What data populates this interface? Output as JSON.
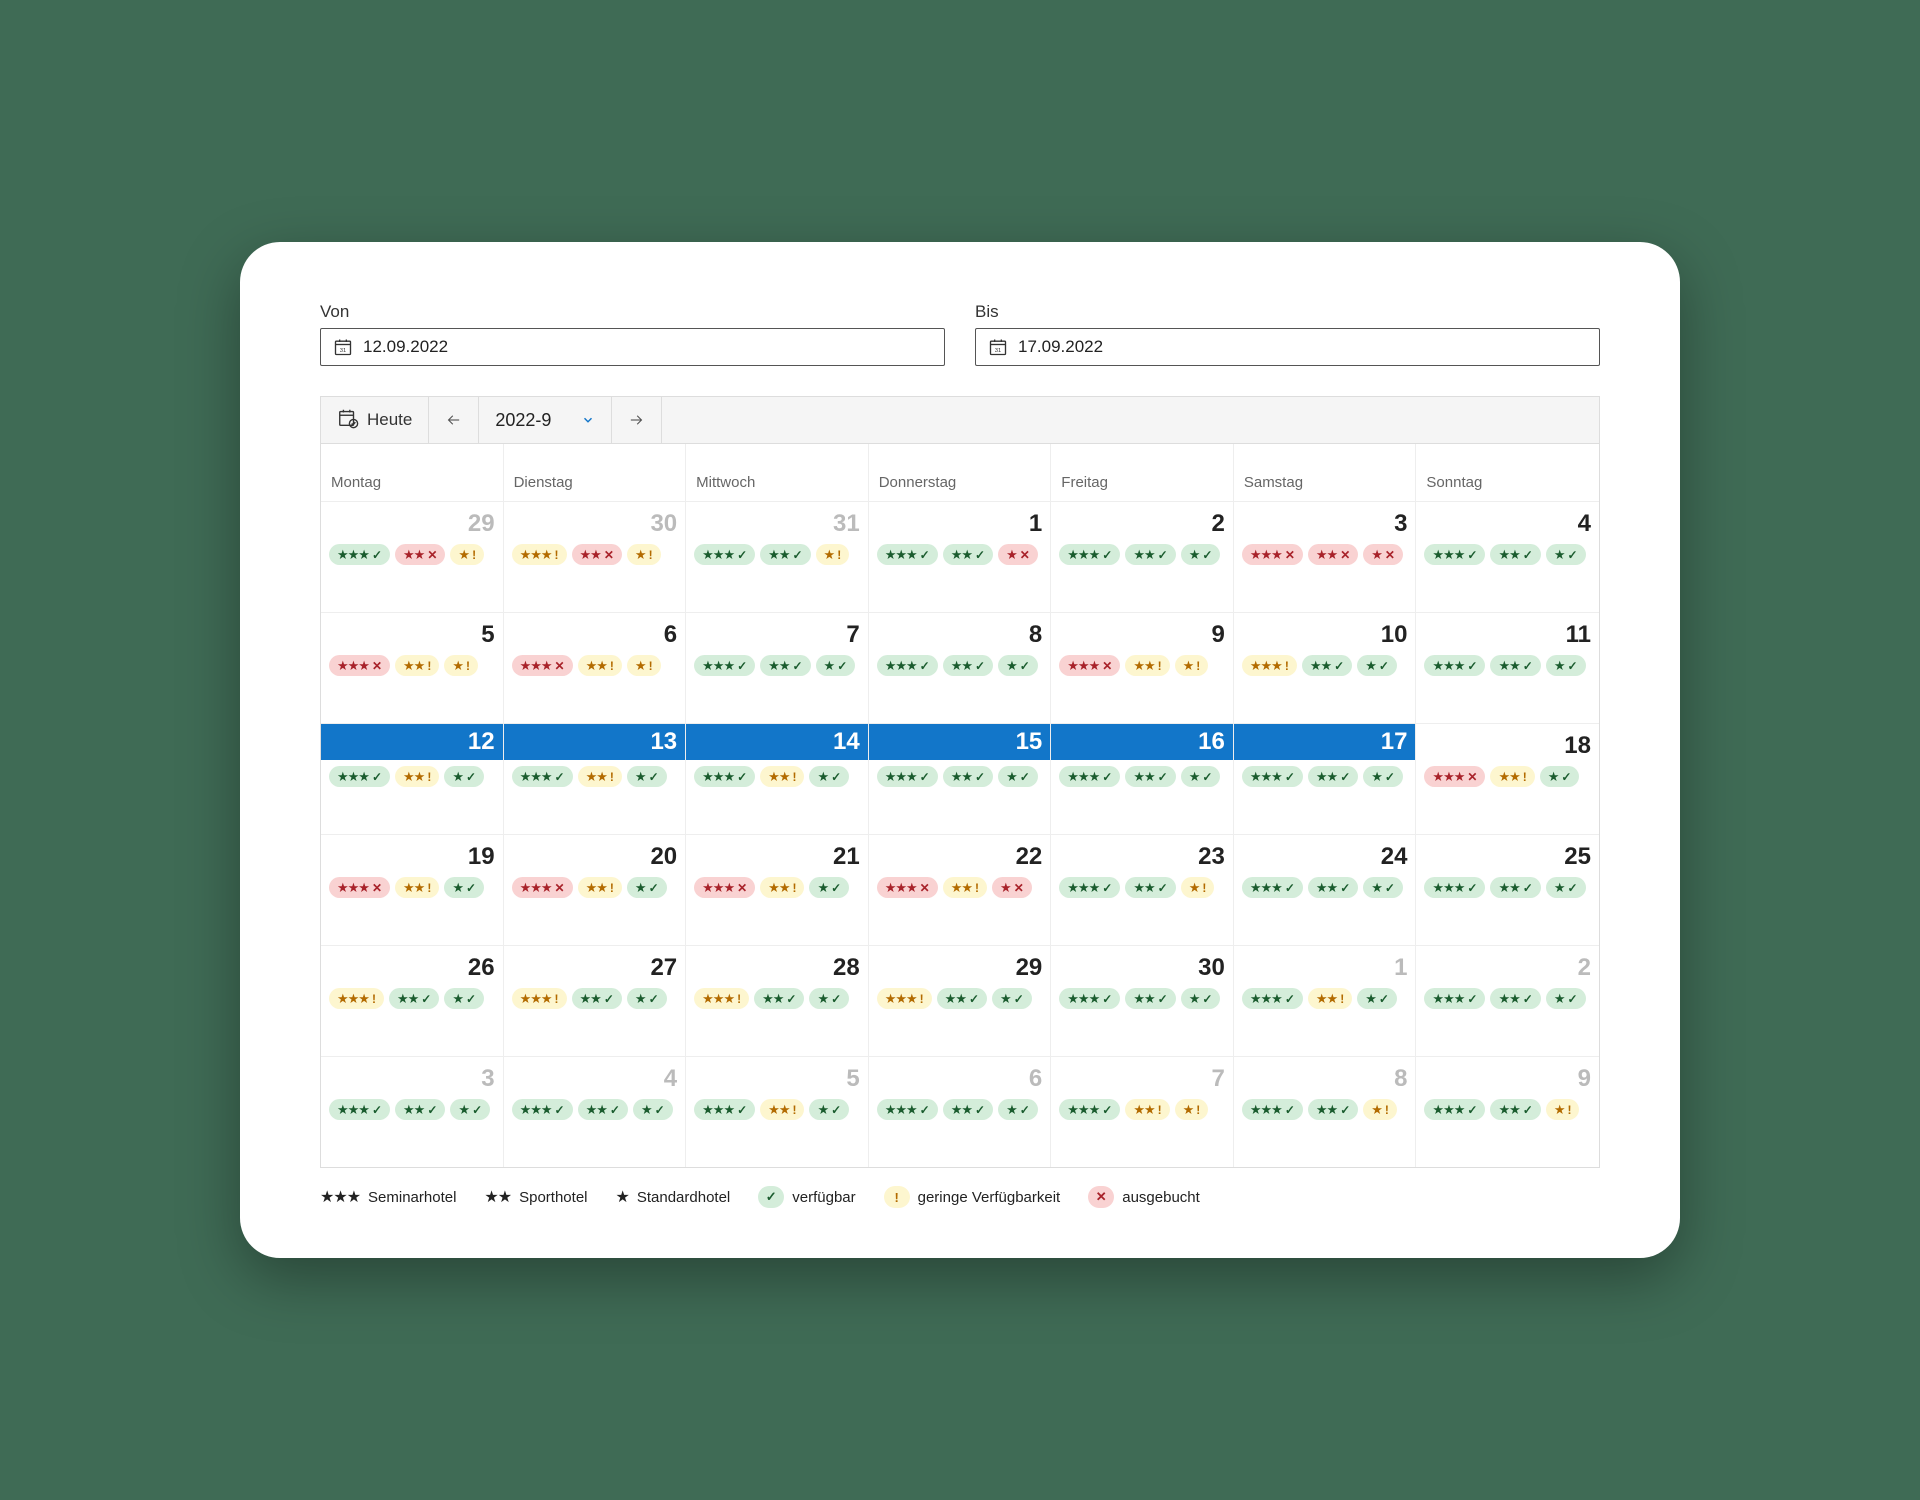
{
  "inputs": {
    "from_label": "Von",
    "from_value": "12.09.2022",
    "to_label": "Bis",
    "to_value": "17.09.2022"
  },
  "toolbar": {
    "today_label": "Heute",
    "month_label": "2022-9"
  },
  "weekdays": [
    "Montag",
    "Dienstag",
    "Mittwoch",
    "Donnerstag",
    "Freitag",
    "Samstag",
    "Sonntag"
  ],
  "legend": {
    "seminar": "Seminarhotel",
    "sport": "Sporthotel",
    "standard": "Standardhotel",
    "avail": "verfügbar",
    "low": "geringe Verfügbarkeit",
    "sold": "ausgebucht"
  },
  "weeks": [
    [
      {
        "n": "29",
        "other": true,
        "sel": false,
        "b": [
          {
            "s": 3,
            "t": "g"
          },
          {
            "s": 2,
            "t": "r"
          },
          {
            "s": 1,
            "t": "y"
          }
        ]
      },
      {
        "n": "30",
        "other": true,
        "sel": false,
        "b": [
          {
            "s": 3,
            "t": "y"
          },
          {
            "s": 2,
            "t": "r"
          },
          {
            "s": 1,
            "t": "y"
          }
        ]
      },
      {
        "n": "31",
        "other": true,
        "sel": false,
        "b": [
          {
            "s": 3,
            "t": "g"
          },
          {
            "s": 2,
            "t": "g"
          },
          {
            "s": 1,
            "t": "y"
          }
        ]
      },
      {
        "n": "1",
        "other": false,
        "sel": false,
        "b": [
          {
            "s": 3,
            "t": "g"
          },
          {
            "s": 2,
            "t": "g"
          },
          {
            "s": 1,
            "t": "r"
          }
        ]
      },
      {
        "n": "2",
        "other": false,
        "sel": false,
        "b": [
          {
            "s": 3,
            "t": "g"
          },
          {
            "s": 2,
            "t": "g"
          },
          {
            "s": 1,
            "t": "g"
          }
        ]
      },
      {
        "n": "3",
        "other": false,
        "sel": false,
        "b": [
          {
            "s": 3,
            "t": "r"
          },
          {
            "s": 2,
            "t": "r"
          },
          {
            "s": 1,
            "t": "r"
          }
        ]
      },
      {
        "n": "4",
        "other": false,
        "sel": false,
        "b": [
          {
            "s": 3,
            "t": "g"
          },
          {
            "s": 2,
            "t": "g"
          },
          {
            "s": 1,
            "t": "g"
          }
        ]
      }
    ],
    [
      {
        "n": "5",
        "other": false,
        "sel": false,
        "b": [
          {
            "s": 3,
            "t": "r"
          },
          {
            "s": 2,
            "t": "y"
          },
          {
            "s": 1,
            "t": "y"
          }
        ]
      },
      {
        "n": "6",
        "other": false,
        "sel": false,
        "b": [
          {
            "s": 3,
            "t": "r"
          },
          {
            "s": 2,
            "t": "y"
          },
          {
            "s": 1,
            "t": "y"
          }
        ]
      },
      {
        "n": "7",
        "other": false,
        "sel": false,
        "b": [
          {
            "s": 3,
            "t": "g"
          },
          {
            "s": 2,
            "t": "g"
          },
          {
            "s": 1,
            "t": "g"
          }
        ]
      },
      {
        "n": "8",
        "other": false,
        "sel": false,
        "b": [
          {
            "s": 3,
            "t": "g"
          },
          {
            "s": 2,
            "t": "g"
          },
          {
            "s": 1,
            "t": "g"
          }
        ]
      },
      {
        "n": "9",
        "other": false,
        "sel": false,
        "b": [
          {
            "s": 3,
            "t": "r"
          },
          {
            "s": 2,
            "t": "y"
          },
          {
            "s": 1,
            "t": "y"
          }
        ]
      },
      {
        "n": "10",
        "other": false,
        "sel": false,
        "b": [
          {
            "s": 3,
            "t": "y"
          },
          {
            "s": 2,
            "t": "g"
          },
          {
            "s": 1,
            "t": "g"
          }
        ]
      },
      {
        "n": "11",
        "other": false,
        "sel": false,
        "b": [
          {
            "s": 3,
            "t": "g"
          },
          {
            "s": 2,
            "t": "g"
          },
          {
            "s": 1,
            "t": "g"
          }
        ]
      }
    ],
    [
      {
        "n": "12",
        "other": false,
        "sel": true,
        "b": [
          {
            "s": 3,
            "t": "g"
          },
          {
            "s": 2,
            "t": "y"
          },
          {
            "s": 1,
            "t": "g"
          }
        ]
      },
      {
        "n": "13",
        "other": false,
        "sel": true,
        "b": [
          {
            "s": 3,
            "t": "g"
          },
          {
            "s": 2,
            "t": "y"
          },
          {
            "s": 1,
            "t": "g"
          }
        ]
      },
      {
        "n": "14",
        "other": false,
        "sel": true,
        "b": [
          {
            "s": 3,
            "t": "g"
          },
          {
            "s": 2,
            "t": "y"
          },
          {
            "s": 1,
            "t": "g"
          }
        ]
      },
      {
        "n": "15",
        "other": false,
        "sel": true,
        "b": [
          {
            "s": 3,
            "t": "g"
          },
          {
            "s": 2,
            "t": "g"
          },
          {
            "s": 1,
            "t": "g"
          }
        ]
      },
      {
        "n": "16",
        "other": false,
        "sel": true,
        "b": [
          {
            "s": 3,
            "t": "g"
          },
          {
            "s": 2,
            "t": "g"
          },
          {
            "s": 1,
            "t": "g"
          }
        ]
      },
      {
        "n": "17",
        "other": false,
        "sel": true,
        "b": [
          {
            "s": 3,
            "t": "g"
          },
          {
            "s": 2,
            "t": "g"
          },
          {
            "s": 1,
            "t": "g"
          }
        ]
      },
      {
        "n": "18",
        "other": false,
        "sel": false,
        "b": [
          {
            "s": 3,
            "t": "r"
          },
          {
            "s": 2,
            "t": "y"
          },
          {
            "s": 1,
            "t": "g"
          }
        ]
      }
    ],
    [
      {
        "n": "19",
        "other": false,
        "sel": false,
        "b": [
          {
            "s": 3,
            "t": "r"
          },
          {
            "s": 2,
            "t": "y"
          },
          {
            "s": 1,
            "t": "g"
          }
        ]
      },
      {
        "n": "20",
        "other": false,
        "sel": false,
        "b": [
          {
            "s": 3,
            "t": "r"
          },
          {
            "s": 2,
            "t": "y"
          },
          {
            "s": 1,
            "t": "g"
          }
        ]
      },
      {
        "n": "21",
        "other": false,
        "sel": false,
        "b": [
          {
            "s": 3,
            "t": "r"
          },
          {
            "s": 2,
            "t": "y"
          },
          {
            "s": 1,
            "t": "g"
          }
        ]
      },
      {
        "n": "22",
        "other": false,
        "sel": false,
        "b": [
          {
            "s": 3,
            "t": "r"
          },
          {
            "s": 2,
            "t": "y"
          },
          {
            "s": 1,
            "t": "r"
          }
        ]
      },
      {
        "n": "23",
        "other": false,
        "sel": false,
        "b": [
          {
            "s": 3,
            "t": "g"
          },
          {
            "s": 2,
            "t": "g"
          },
          {
            "s": 1,
            "t": "y"
          }
        ]
      },
      {
        "n": "24",
        "other": false,
        "sel": false,
        "b": [
          {
            "s": 3,
            "t": "g"
          },
          {
            "s": 2,
            "t": "g"
          },
          {
            "s": 1,
            "t": "g"
          }
        ]
      },
      {
        "n": "25",
        "other": false,
        "sel": false,
        "b": [
          {
            "s": 3,
            "t": "g"
          },
          {
            "s": 2,
            "t": "g"
          },
          {
            "s": 1,
            "t": "g"
          }
        ]
      }
    ],
    [
      {
        "n": "26",
        "other": false,
        "sel": false,
        "b": [
          {
            "s": 3,
            "t": "y"
          },
          {
            "s": 2,
            "t": "g"
          },
          {
            "s": 1,
            "t": "g"
          }
        ]
      },
      {
        "n": "27",
        "other": false,
        "sel": false,
        "b": [
          {
            "s": 3,
            "t": "y"
          },
          {
            "s": 2,
            "t": "g"
          },
          {
            "s": 1,
            "t": "g"
          }
        ]
      },
      {
        "n": "28",
        "other": false,
        "sel": false,
        "b": [
          {
            "s": 3,
            "t": "y"
          },
          {
            "s": 2,
            "t": "g"
          },
          {
            "s": 1,
            "t": "g"
          }
        ]
      },
      {
        "n": "29",
        "other": false,
        "sel": false,
        "b": [
          {
            "s": 3,
            "t": "y"
          },
          {
            "s": 2,
            "t": "g"
          },
          {
            "s": 1,
            "t": "g"
          }
        ]
      },
      {
        "n": "30",
        "other": false,
        "sel": false,
        "b": [
          {
            "s": 3,
            "t": "g"
          },
          {
            "s": 2,
            "t": "g"
          },
          {
            "s": 1,
            "t": "g"
          }
        ]
      },
      {
        "n": "1",
        "other": true,
        "sel": false,
        "b": [
          {
            "s": 3,
            "t": "g"
          },
          {
            "s": 2,
            "t": "y"
          },
          {
            "s": 1,
            "t": "g"
          }
        ]
      },
      {
        "n": "2",
        "other": true,
        "sel": false,
        "b": [
          {
            "s": 3,
            "t": "g"
          },
          {
            "s": 2,
            "t": "g"
          },
          {
            "s": 1,
            "t": "g"
          }
        ]
      }
    ],
    [
      {
        "n": "3",
        "other": true,
        "sel": false,
        "b": [
          {
            "s": 3,
            "t": "g"
          },
          {
            "s": 2,
            "t": "g"
          },
          {
            "s": 1,
            "t": "g"
          }
        ]
      },
      {
        "n": "4",
        "other": true,
        "sel": false,
        "b": [
          {
            "s": 3,
            "t": "g"
          },
          {
            "s": 2,
            "t": "g"
          },
          {
            "s": 1,
            "t": "g"
          }
        ]
      },
      {
        "n": "5",
        "other": true,
        "sel": false,
        "b": [
          {
            "s": 3,
            "t": "g"
          },
          {
            "s": 2,
            "t": "y"
          },
          {
            "s": 1,
            "t": "g"
          }
        ]
      },
      {
        "n": "6",
        "other": true,
        "sel": false,
        "b": [
          {
            "s": 3,
            "t": "g"
          },
          {
            "s": 2,
            "t": "g"
          },
          {
            "s": 1,
            "t": "g"
          }
        ]
      },
      {
        "n": "7",
        "other": true,
        "sel": false,
        "b": [
          {
            "s": 3,
            "t": "g"
          },
          {
            "s": 2,
            "t": "y"
          },
          {
            "s": 1,
            "t": "y"
          }
        ]
      },
      {
        "n": "8",
        "other": true,
        "sel": false,
        "b": [
          {
            "s": 3,
            "t": "g"
          },
          {
            "s": 2,
            "t": "g"
          },
          {
            "s": 1,
            "t": "y"
          }
        ]
      },
      {
        "n": "9",
        "other": true,
        "sel": false,
        "b": [
          {
            "s": 3,
            "t": "g"
          },
          {
            "s": 2,
            "t": "g"
          },
          {
            "s": 1,
            "t": "y"
          }
        ]
      }
    ]
  ]
}
